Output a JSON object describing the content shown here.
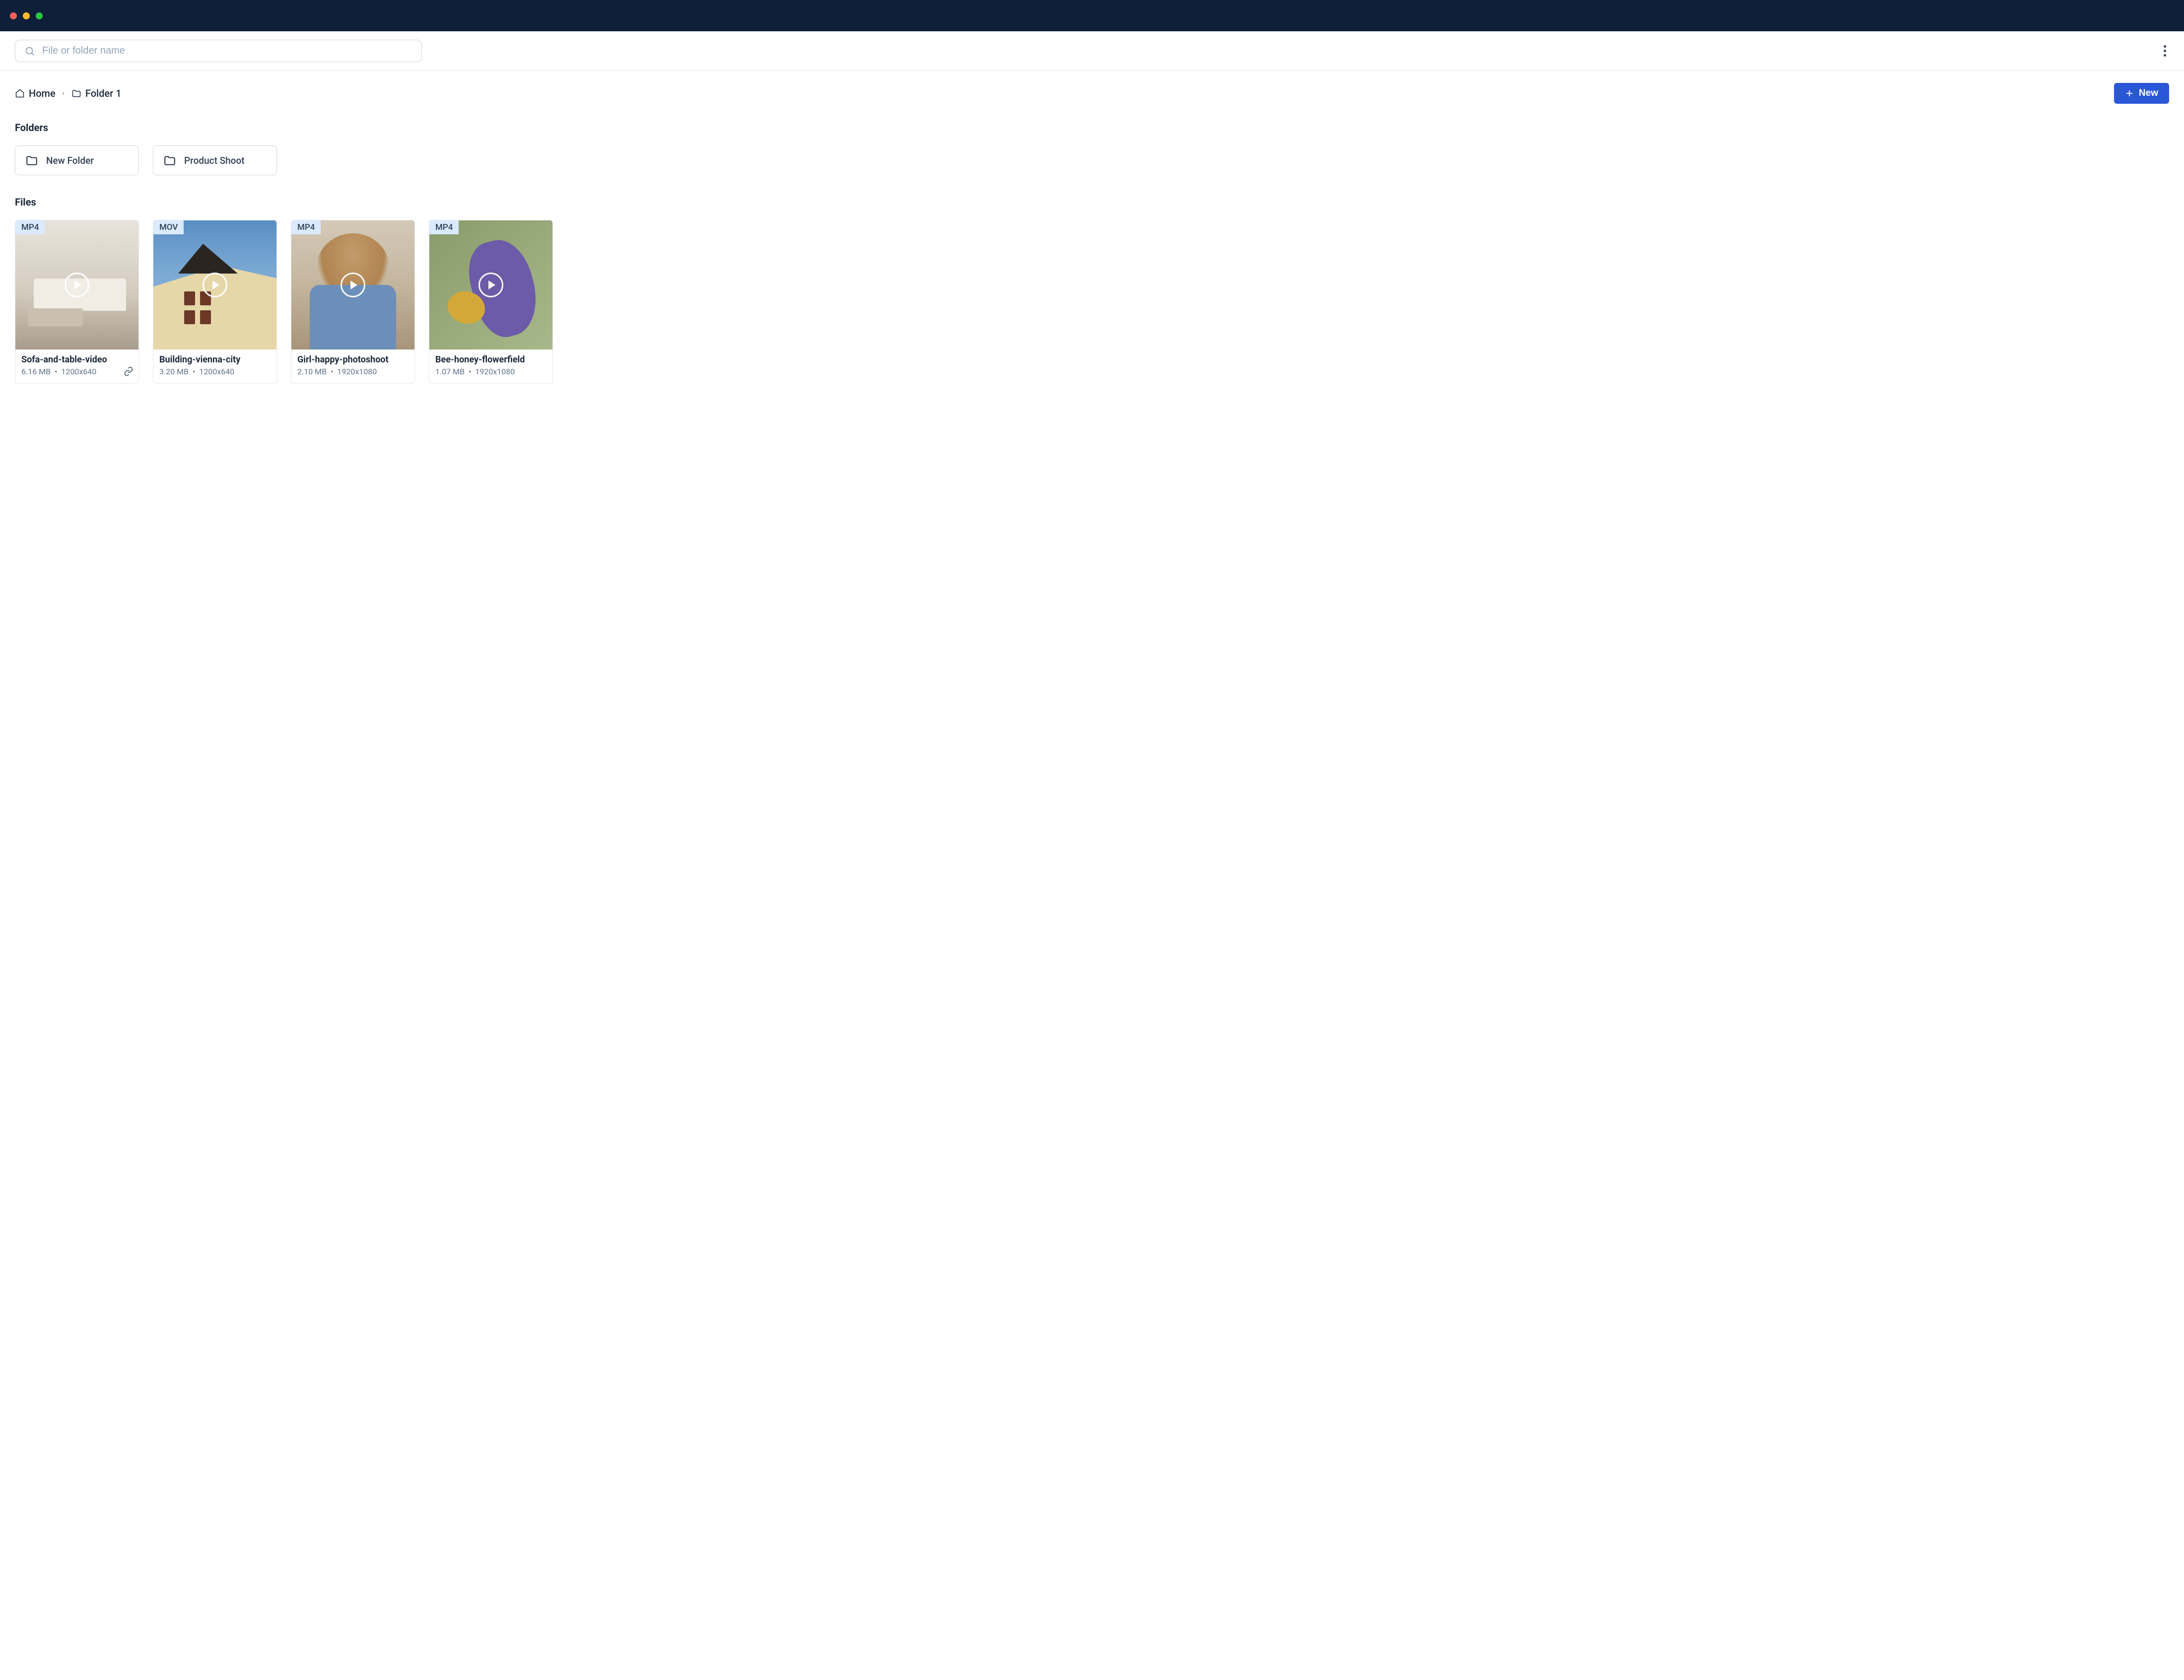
{
  "search": {
    "placeholder": "File or folder name"
  },
  "breadcrumb": {
    "home": "Home",
    "current": "Folder 1"
  },
  "buttons": {
    "new_label": "New"
  },
  "sections": {
    "folders_title": "Folders",
    "files_title": "Files"
  },
  "folders": [
    {
      "name": "New Folder"
    },
    {
      "name": "Product Shoot"
    }
  ],
  "files": [
    {
      "format": "MP4",
      "title": "Sofa-and-table-video",
      "size": "6.16 MB",
      "sep": "•",
      "dimensions": "1200x640",
      "has_link": true
    },
    {
      "format": "MOV",
      "title": "Building-vienna-city",
      "size": "3.20 MB",
      "sep": "•",
      "dimensions": "1200x640",
      "has_link": false
    },
    {
      "format": "MP4",
      "title": "Girl-happy-photoshoot",
      "size": "2.10 MB",
      "sep": "•",
      "dimensions": "1920x1080",
      "has_link": false
    },
    {
      "format": "MP4",
      "title": "Bee-honey-flowerfield",
      "size": "1.07 MB",
      "sep": "•",
      "dimensions": "1920x1080",
      "has_link": false
    }
  ]
}
